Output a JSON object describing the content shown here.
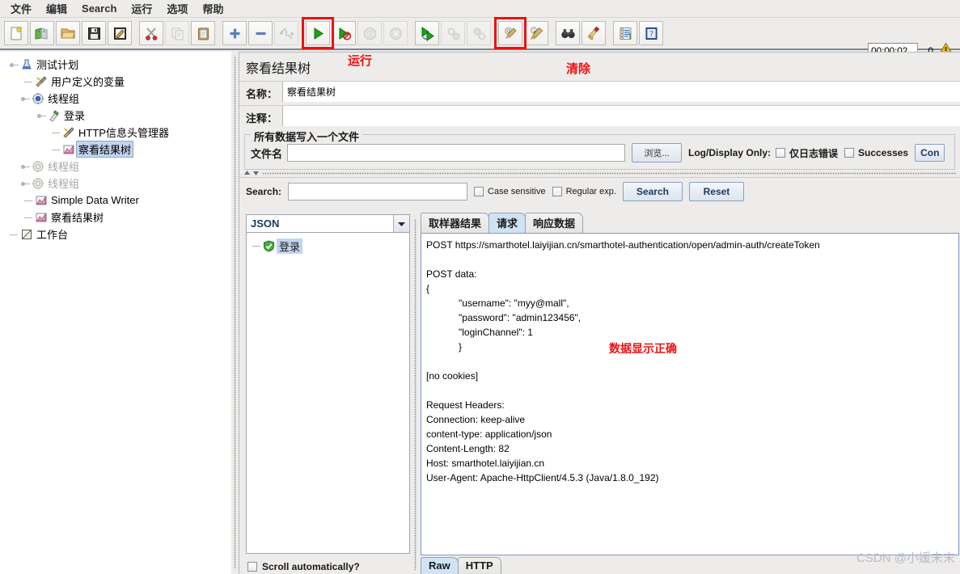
{
  "menubar": {
    "items": [
      {
        "label": "文件",
        "name": "menu-file"
      },
      {
        "label": "编辑",
        "name": "menu-edit"
      },
      {
        "label": "Search",
        "name": "menu-search"
      },
      {
        "label": "运行",
        "name": "menu-run"
      },
      {
        "label": "选项",
        "name": "menu-options"
      },
      {
        "label": "帮助",
        "name": "menu-help"
      }
    ]
  },
  "toolbar": {
    "buttons": [
      {
        "icon": "new-file-icon",
        "name": "new-button",
        "enabled": true
      },
      {
        "icon": "templates-icon",
        "name": "templates-button",
        "enabled": true
      },
      {
        "icon": "open-folder-icon",
        "name": "open-button",
        "enabled": true
      },
      {
        "icon": "save-disk-icon",
        "name": "save-button",
        "enabled": true
      },
      {
        "icon": "save-as-icon",
        "name": "save-as-button",
        "enabled": true
      },
      {
        "icon": "scissors-icon",
        "name": "cut-button",
        "enabled": true
      },
      {
        "icon": "copy-icon",
        "name": "copy-button",
        "enabled": false
      },
      {
        "icon": "paste-clipboard-icon",
        "name": "paste-button",
        "enabled": true
      },
      {
        "icon": "plus-icon",
        "name": "expand-all-button",
        "enabled": true
      },
      {
        "icon": "minus-icon",
        "name": "collapse-all-button",
        "enabled": true
      },
      {
        "icon": "toggle-icon",
        "name": "toggle-button",
        "enabled": false
      },
      {
        "icon": "play-triangle-icon",
        "name": "start-button",
        "enabled": true,
        "highlight": true
      },
      {
        "icon": "play-no-timers-icon",
        "name": "start-no-pauses-button",
        "enabled": true
      },
      {
        "icon": "stop-sign-icon",
        "name": "stop-button",
        "enabled": false
      },
      {
        "icon": "shutdown-icon",
        "name": "shutdown-button",
        "enabled": false
      },
      {
        "icon": "remote-start-icon",
        "name": "remote-start-all-button",
        "enabled": true
      },
      {
        "icon": "remote-stop-icon",
        "name": "remote-stop-all-button",
        "enabled": false
      },
      {
        "icon": "remote-shutdown-icon",
        "name": "remote-shutdown-all-button",
        "enabled": false
      },
      {
        "icon": "clear-gear-broom-icon",
        "name": "clear-button",
        "enabled": true,
        "highlight": true
      },
      {
        "icon": "clear-all-broom-icon",
        "name": "clear-all-button",
        "enabled": true
      },
      {
        "icon": "binoculars-icon",
        "name": "search-button",
        "enabled": true
      },
      {
        "icon": "reset-broom-icon",
        "name": "reset-search-button",
        "enabled": true
      },
      {
        "icon": "function-helper-icon",
        "name": "function-helper-button",
        "enabled": true
      },
      {
        "icon": "help-book-icon",
        "name": "help-button",
        "enabled": true
      }
    ],
    "timer": "00:00:02",
    "warning_count": "0",
    "warning_icon": "warning-triangle-icon"
  },
  "annotations": [
    {
      "text": "运行",
      "name": "annotation-run",
      "color": "#ee1111"
    },
    {
      "text": "清除",
      "name": "annotation-clear",
      "color": "#ee1111"
    },
    {
      "text": "数据显示正确",
      "name": "annotation-data-correct",
      "color": "#ee1111"
    }
  ],
  "tree": {
    "nodes": [
      {
        "label": "测试计划",
        "depth": 0,
        "icon": "test-plan-flask-icon",
        "handle": "expanded",
        "selected": false,
        "muted": false
      },
      {
        "label": "用户定义的变量",
        "depth": 1,
        "icon": "config-tools-icon",
        "handle": "leaf",
        "selected": false,
        "muted": false
      },
      {
        "label": "线程组",
        "depth": 1,
        "icon": "thread-group-gear-icon",
        "handle": "expanded",
        "selected": false,
        "muted": false
      },
      {
        "label": "登录",
        "depth": 2,
        "icon": "sampler-pipette-icon",
        "handle": "expanded",
        "selected": false,
        "muted": false
      },
      {
        "label": "HTTP信息头管理器",
        "depth": 2,
        "icon": "config-tools-icon",
        "handle": "leaf",
        "selected": false,
        "muted": false
      },
      {
        "label": "察看结果树",
        "depth": 2,
        "icon": "listener-chart-icon",
        "handle": "leaf",
        "selected": true,
        "muted": false
      },
      {
        "label": "线程组",
        "depth": 1,
        "icon": "thread-group-gear-gray-icon",
        "handle": "expanded",
        "selected": false,
        "muted": true
      },
      {
        "label": "线程组",
        "depth": 1,
        "icon": "thread-group-gear-gray-icon",
        "handle": "expanded",
        "selected": false,
        "muted": true
      },
      {
        "label": "Simple Data Writer",
        "depth": 1,
        "icon": "listener-chart-icon",
        "handle": "leaf",
        "selected": false,
        "muted": false
      },
      {
        "label": "察看结果树",
        "depth": 1,
        "icon": "listener-chart-icon",
        "handle": "leaf",
        "selected": false,
        "muted": false
      },
      {
        "label": "工作台",
        "depth": 0,
        "icon": "workbench-icon",
        "handle": "leaf",
        "selected": false,
        "muted": false
      }
    ]
  },
  "panel": {
    "title": "察看结果树",
    "name_label": "名称：",
    "name_value": "察看结果树",
    "comment_label": "注释：",
    "comment_value": "",
    "group_title": "所有数据写入一个文件",
    "filename_label": "文件名",
    "filename_value": "",
    "filename_placeholder": "",
    "browse_label": "浏览...",
    "log_display_label": "Log/Display Only:",
    "errors_only_label": "仅日志错误",
    "errors_only_checked": false,
    "successes_label": "Successes",
    "successes_checked": false,
    "configure_label": "Con"
  },
  "search": {
    "label": "Search:",
    "value": "",
    "placeholder": "",
    "case_sensitive_label": "Case sensitive",
    "case_sensitive_checked": false,
    "regex_label": "Regular exp.",
    "regex_checked": false,
    "search_button": "Search",
    "reset_button": "Reset"
  },
  "results": {
    "renderer_selected": "JSON",
    "renderer_options": [
      "JSON"
    ],
    "renderer_arrow_icon": "chevron-down-icon",
    "items": [
      {
        "label": "登录",
        "icon": "success-shield-check-icon",
        "selected": true
      }
    ],
    "scroll_auto_label": "Scroll automatically?",
    "scroll_auto_checked": false
  },
  "tabs": {
    "items": [
      {
        "label": "取样器结果",
        "name": "tab-sampler-result",
        "active": false
      },
      {
        "label": "请求",
        "name": "tab-request",
        "active": true
      },
      {
        "label": "响应数据",
        "name": "tab-response-data",
        "active": false
      }
    ],
    "bottom_items": [
      {
        "label": "Raw",
        "name": "tab-raw",
        "active": true
      },
      {
        "label": "HTTP",
        "name": "tab-http",
        "active": false
      }
    ]
  },
  "request_body": "POST https://smarthotel.laiyijian.cn/smarthotel-authentication/open/admin-auth/createToken\n\nPOST data:\n{\n            \"username\": \"myy@mall\",\n            \"password\": \"admin123456\",\n            \"loginChannel\": 1\n            }\n\n[no cookies]\n\nRequest Headers:\nConnection: keep-alive\ncontent-type: application/json\nContent-Length: 82\nHost: smarthotel.laiyijian.cn\nUser-Agent: Apache-HttpClient/4.5.3 (Java/1.8.0_192)",
  "watermark": "CSDN @小媛未末"
}
